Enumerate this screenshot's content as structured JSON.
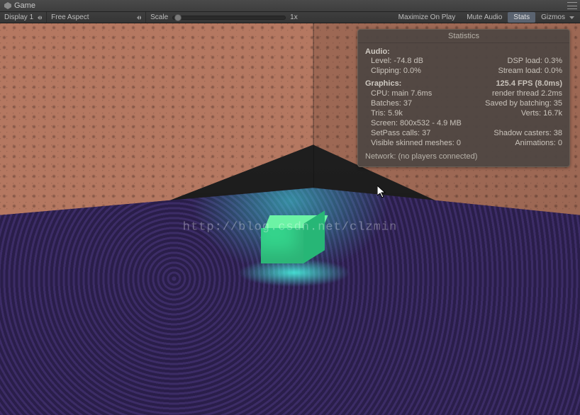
{
  "titlebar": {
    "title": "Game"
  },
  "toolbar": {
    "display": "Display 1",
    "aspect": "Free Aspect",
    "scale_label": "Scale",
    "scale_value": "1x",
    "maximize": "Maximize On Play",
    "mute": "Mute Audio",
    "stats": "Stats",
    "gizmos": "Gizmos"
  },
  "watermark": "http://blog.csdn.net/clzmin",
  "stats": {
    "panel_title": "Statistics",
    "audio": {
      "heading": "Audio:",
      "level": "Level: -74.8 dB",
      "dsp": "DSP load: 0.3%",
      "clipping": "Clipping: 0.0%",
      "stream": "Stream load: 0.0%"
    },
    "graphics": {
      "heading": "Graphics:",
      "fps": "125.4 FPS (8.0ms)",
      "cpu": "CPU: main 7.6ms",
      "render": "render thread 2.2ms",
      "batches": "Batches: 37",
      "saved": "Saved by batching: 35",
      "tris": "Tris: 5.9k",
      "verts": "Verts: 16.7k",
      "screen": "Screen: 800x532 - 4.9 MB",
      "setpass": "SetPass calls: 37",
      "shadow": "Shadow casters: 38",
      "skinned": "Visible skinned meshes: 0",
      "anim": "Animations: 0"
    },
    "network": "Network: (no players connected)"
  }
}
